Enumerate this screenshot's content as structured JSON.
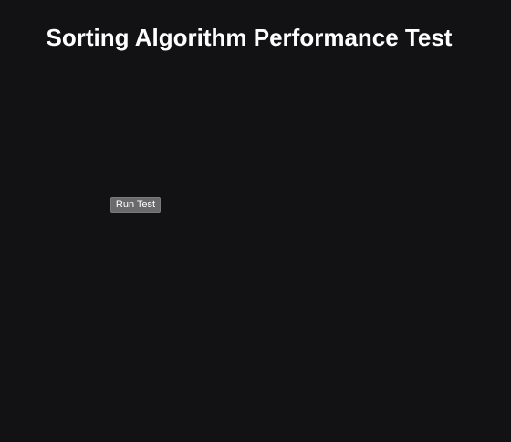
{
  "page": {
    "title": "Sorting Algorithm Performance Test"
  },
  "controls": {
    "run_button_label": "Run Test"
  },
  "colors": {
    "background": "#121113",
    "title_text": "#ffffff",
    "button_background": "#6a6a6a",
    "button_text": "#ffffff"
  }
}
